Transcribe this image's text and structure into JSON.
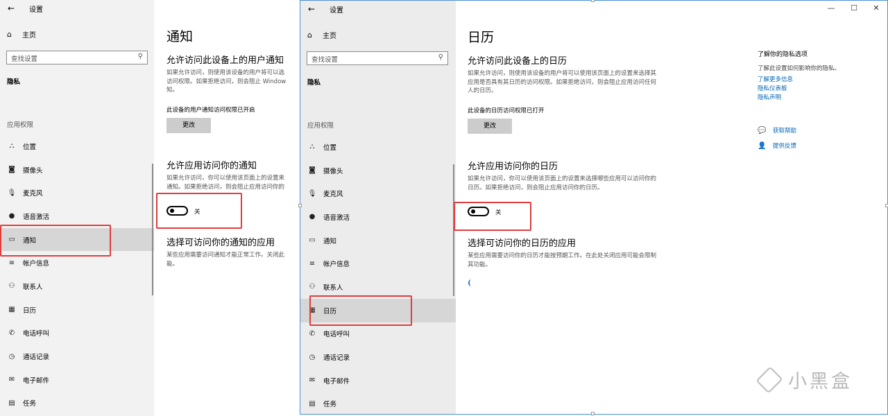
{
  "colors": {
    "accent": "#0066b4",
    "highlight": "#e03c3c",
    "sidebar_bg": "#f2f2f2",
    "active_item": "#d6d6d6",
    "button_bg": "#cccccc"
  },
  "left_window": {
    "title": "设置",
    "home": "主页",
    "search_placeholder": "查找设置",
    "section": "隐私",
    "app_permissions": "应用权限",
    "nav": [
      {
        "icon": "location-icon",
        "glyph": "⛬",
        "label": "位置"
      },
      {
        "icon": "camera-icon",
        "glyph": "◙",
        "label": "摄像头"
      },
      {
        "icon": "microphone-icon",
        "glyph": "🎙",
        "label": "麦克风"
      },
      {
        "icon": "voice-activation-icon",
        "glyph": "●",
        "label": "语音激活"
      },
      {
        "icon": "notification-icon",
        "glyph": "▭",
        "label": "通知",
        "active": true
      },
      {
        "icon": "account-info-icon",
        "glyph": "≡",
        "label": "帐户信息"
      },
      {
        "icon": "contacts-icon",
        "glyph": "⚇",
        "label": "联系人"
      },
      {
        "icon": "calendar-icon",
        "glyph": "▦",
        "label": "日历"
      },
      {
        "icon": "phone-icon",
        "glyph": "✆",
        "label": "电话呼叫"
      },
      {
        "icon": "call-history-icon",
        "glyph": "◷",
        "label": "通话记录"
      },
      {
        "icon": "email-icon",
        "glyph": "✉",
        "label": "电子邮件"
      },
      {
        "icon": "tasks-icon",
        "glyph": "▤",
        "label": "任务"
      }
    ],
    "page_title": "通知",
    "device_heading": "允许访问此设备上的用户通知",
    "device_desc": "如果允许访问，则使用该设备的用户将可以选\n访问权限。如果拒绝访问，则会阻止 Window\n知。",
    "device_status": "此设备的用户通知访问权限已开启",
    "change_button": "更改",
    "app_heading": "允许应用访问你的通知",
    "app_desc": "如果允许访问，你可以使用该页面上的设置来\n通知。如果拒绝访问，则会阻止应用访问你的",
    "toggle_label": "关",
    "choose_heading": "选择可访问你的通知的应用",
    "choose_desc": "某些应用需要访问通知才能正常工作。关闭此\n能。"
  },
  "right_window": {
    "title": "设置",
    "home": "主页",
    "search_placeholder": "查找设置",
    "section": "隐私",
    "app_permissions": "应用权限",
    "nav": [
      {
        "icon": "location-icon",
        "glyph": "⛬",
        "label": "位置"
      },
      {
        "icon": "camera-icon",
        "glyph": "◙",
        "label": "摄像头"
      },
      {
        "icon": "microphone-icon",
        "glyph": "🎙",
        "label": "麦克风"
      },
      {
        "icon": "voice-activation-icon",
        "glyph": "●",
        "label": "语音激活"
      },
      {
        "icon": "notification-icon",
        "glyph": "▭",
        "label": "通知"
      },
      {
        "icon": "account-info-icon",
        "glyph": "≡",
        "label": "帐户信息"
      },
      {
        "icon": "contacts-icon",
        "glyph": "⚇",
        "label": "联系人"
      },
      {
        "icon": "calendar-icon",
        "glyph": "▦",
        "label": "日历",
        "active": true
      },
      {
        "icon": "phone-icon",
        "glyph": "✆",
        "label": "电话呼叫"
      },
      {
        "icon": "call-history-icon",
        "glyph": "◷",
        "label": "通话记录"
      },
      {
        "icon": "email-icon",
        "glyph": "✉",
        "label": "电子邮件"
      },
      {
        "icon": "tasks-icon",
        "glyph": "▤",
        "label": "任务"
      }
    ],
    "page_title": "日历",
    "device_heading": "允许访问此设备上的日历",
    "device_desc": "如果允许访问，则使用该设备的用户将可以使用该页面上的设置来选择其\n应用是否具有其日历的访问权限。如果拒绝访问，则会阻止应用访问任何\n人的日历。",
    "device_status": "此设备的日历访问权限已打开",
    "change_button": "更改",
    "app_heading": "允许应用访问你的日历",
    "app_desc": "如果允许访问，你可以使用该页面上的设置来选择哪些应用可以访问你的\n日历。如果拒绝访问，则会阻止应用访问你的日历。",
    "toggle_label": "关",
    "choose_heading": "选择可访问你的日历的应用",
    "choose_desc": "某些应用需要访问你的日历才能按预期工作。在此处关闭应用可能会限制\n其功能。",
    "controls": {
      "minimize": "—",
      "maximize": "☐",
      "close": "✕"
    },
    "related": {
      "title": "了解你的隐私选项",
      "text": "了解此设置如何影响你的隐私。",
      "links": [
        "了解更多信息",
        "隐私仪表板",
        "隐私声明"
      ],
      "help": "获取帮助",
      "feedback": "提供反馈"
    }
  },
  "watermark": "小黑盒"
}
